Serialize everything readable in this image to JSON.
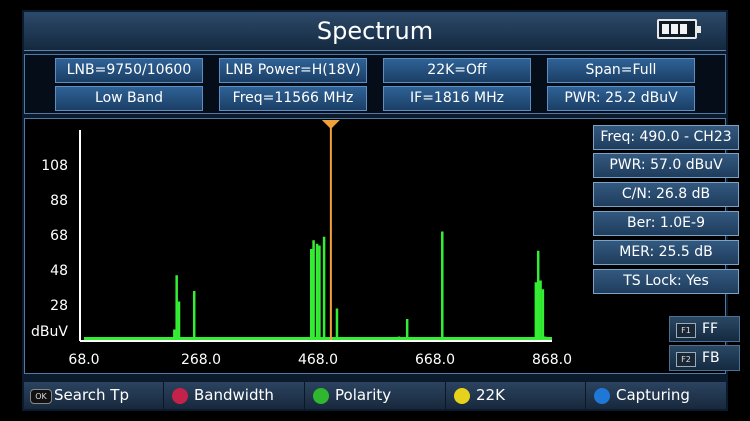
{
  "header": {
    "title": "Spectrum",
    "battery_level": 3,
    "battery_icon": "battery-icon"
  },
  "params": {
    "lnb": "LNB=9750/10600",
    "lnb_power": "LNB Power=H(18V)",
    "k22": "22K=Off",
    "span": "Span=Full",
    "band": "Low Band",
    "freq": "Freq=11566 MHz",
    "if": "IF=1816 MHz",
    "pwr": "PWR: 25.2 dBuV"
  },
  "measurements": {
    "freq": "Freq: 490.0 - CH23",
    "pwr": "PWR: 57.0 dBuV",
    "cn": "C/N: 26.8 dB",
    "ber": "Ber: 1.0E-9",
    "mer": "MER: 25.5 dB",
    "ts": "TS Lock: Yes"
  },
  "function_buttons": {
    "ff": {
      "key": "F1",
      "label": "FF"
    },
    "fb": {
      "key": "F2",
      "label": "FB"
    }
  },
  "bottom_bar": {
    "search": {
      "key": "OK",
      "label": "Search Tp"
    },
    "bandwidth": {
      "label": "Bandwidth",
      "color": "#c4224a"
    },
    "polarity": {
      "label": "Polarity",
      "color": "#2fb82f"
    },
    "k22": {
      "label": "22K",
      "color": "#e6d21a"
    },
    "capturing": {
      "label": "Capturing",
      "color": "#1f78d6"
    }
  },
  "colors": {
    "trace": "#33ee33",
    "marker": "#f2a13a",
    "axis": "#ffffff"
  },
  "chart_data": {
    "type": "bar",
    "xlim": [
      68.0,
      868.0
    ],
    "ylim": [
      8,
      128
    ],
    "x_ticks": [
      "68.0",
      "268.0",
      "468.0",
      "668.0",
      "868.0"
    ],
    "y_ticks": [
      "108",
      "88",
      "68",
      "48",
      "28"
    ],
    "ylabel": "dBuV",
    "noise_floor": 8,
    "marker_x": 490.0,
    "x": [
      222,
      226,
      230,
      256,
      456,
      460,
      466,
      470,
      478,
      500,
      606,
      620,
      680,
      840,
      844,
      848,
      852,
      856
    ],
    "values": [
      14,
      45,
      30,
      36,
      60,
      65,
      63,
      62,
      67,
      26,
      10,
      20,
      70,
      41,
      59,
      42,
      37,
      10
    ]
  }
}
